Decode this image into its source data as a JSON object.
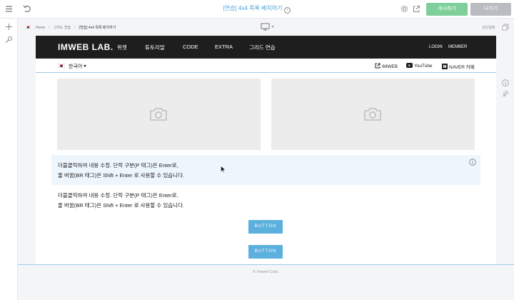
{
  "topbar": {
    "doc_title": "[연습] 4x4 목록 배치하기",
    "info_glyph": "i",
    "publish_label": "게시하기",
    "exit_label": "나가기"
  },
  "crumbs": {
    "home": "Home",
    "section": "그리드 연습",
    "current": "[연습] 4x4 목록 배치하기",
    "top_setting": "상단설정"
  },
  "site": {
    "logo": "IMWEB LAB.",
    "nav": [
      "위젯",
      "튜토리얼",
      "CODE",
      "EXTRA",
      "그리드 연습"
    ],
    "login": "LOGIN",
    "member": "MEMBER",
    "language": "한국어",
    "links": [
      "IMWEB",
      "YouTube",
      "NAVER 카페"
    ]
  },
  "content": {
    "text1_line1": "더블클릭하여 내용 수정. 단락 구분(P 태그)은 Enter로,",
    "text1_line2": "줄 바꿈(BR 태그)은 Shift + Enter 로 사용할 수 있습니다.",
    "text2_line1": "더블클릭하여 내용 수정. 단락 구분(P 태그)은 Enter로,",
    "text2_line2": "줄 바꿈(BR 태그)은 Shift + Enter 로 사용할 수 있습니다.",
    "button1": "BUTTON",
    "button2": "BUTTON"
  },
  "footer": {
    "copyright": "© Imweb Corp."
  },
  "colors": {
    "accent": "#4a9fd8",
    "publish": "#7ecf9a",
    "exit": "#b9bcc0",
    "button": "#5bb0de",
    "header_bg": "#1e1e1e"
  },
  "icons": [
    "menu-icon",
    "undo-icon",
    "info-icon",
    "gear-icon",
    "external-link-icon",
    "plus-icon",
    "wrench-icon",
    "flag-icon",
    "desktop-icon",
    "copy-icon",
    "camera-icon",
    "youtube-icon",
    "naver-icon",
    "pin-icon"
  ]
}
